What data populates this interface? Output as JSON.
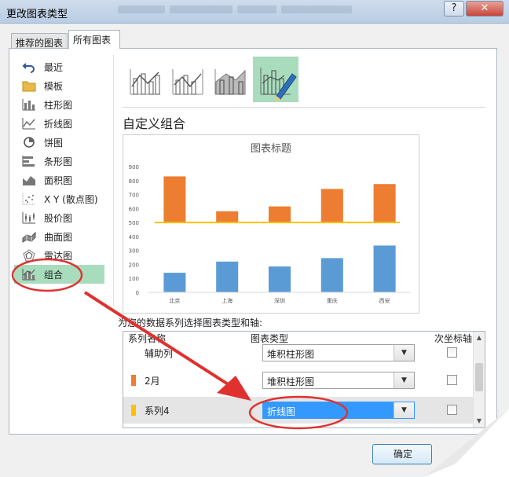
{
  "window": {
    "title": "更改图表类型",
    "help_label": "?",
    "close_label": "✕"
  },
  "tabs": [
    {
      "label": "推荐的图表",
      "active": false
    },
    {
      "label": "所有图表",
      "active": true
    }
  ],
  "sidebar": {
    "items": [
      {
        "label": "最近",
        "icon": "undo-icon"
      },
      {
        "label": "模板",
        "icon": "folder-icon"
      },
      {
        "label": "柱形图",
        "icon": "column-chart-icon"
      },
      {
        "label": "折线图",
        "icon": "line-chart-icon"
      },
      {
        "label": "饼图",
        "icon": "pie-chart-icon"
      },
      {
        "label": "条形图",
        "icon": "bar-chart-icon"
      },
      {
        "label": "面积图",
        "icon": "area-chart-icon"
      },
      {
        "label": "X Y (散点图)",
        "icon": "scatter-chart-icon"
      },
      {
        "label": "股价图",
        "icon": "stock-chart-icon"
      },
      {
        "label": "曲面图",
        "icon": "surface-chart-icon"
      },
      {
        "label": "雷达图",
        "icon": "radar-chart-icon"
      },
      {
        "label": "组合",
        "icon": "combo-chart-icon",
        "selected": true
      }
    ]
  },
  "subtypes": [
    {
      "icon": "clustered-column-line-icon"
    },
    {
      "icon": "clustered-column-line-secondary-icon"
    },
    {
      "icon": "stacked-area-column-icon"
    },
    {
      "icon": "custom-combination-icon",
      "selected": true
    }
  ],
  "section_title": "自定义组合",
  "chart_data": {
    "type": "bar",
    "title": "图表标题",
    "categories": [
      "北京",
      "上海",
      "深圳",
      "重庆",
      "西安"
    ],
    "series": [
      {
        "values": [
          830,
          580,
          615,
          740,
          775
        ],
        "color": "#ed7d31"
      },
      {
        "values": [
          140,
          220,
          185,
          245,
          335
        ],
        "color": "#5b9bd5"
      },
      {
        "values": [
          500,
          500,
          500,
          500,
          500
        ],
        "color": "#ffc000",
        "type": "line"
      }
    ],
    "ylim": [
      0,
      900
    ],
    "yticks": [
      0,
      100,
      200,
      300,
      400,
      500,
      600,
      700,
      800,
      900
    ],
    "grid": false
  },
  "series_config": {
    "caption": "为您的数据系列选择图表类型和轴:",
    "headers": {
      "name": "系列名称",
      "type": "图表类型",
      "secondary": "次坐标轴"
    },
    "rows": [
      {
        "name": "辅助列",
        "type": "堆积柱形图",
        "color": "",
        "selected": false
      },
      {
        "name": "2月",
        "type": "堆积柱形图",
        "color": "#ed7d31",
        "selected": false
      },
      {
        "name": "系列4",
        "type": "折线图",
        "color": "#ffc000",
        "selected": true
      }
    ]
  },
  "buttons": {
    "ok": "确定"
  },
  "colors": {
    "selection": "#a9dcbc",
    "annotation": "#e0312e",
    "dropdown_highlight": "#3399ff"
  }
}
